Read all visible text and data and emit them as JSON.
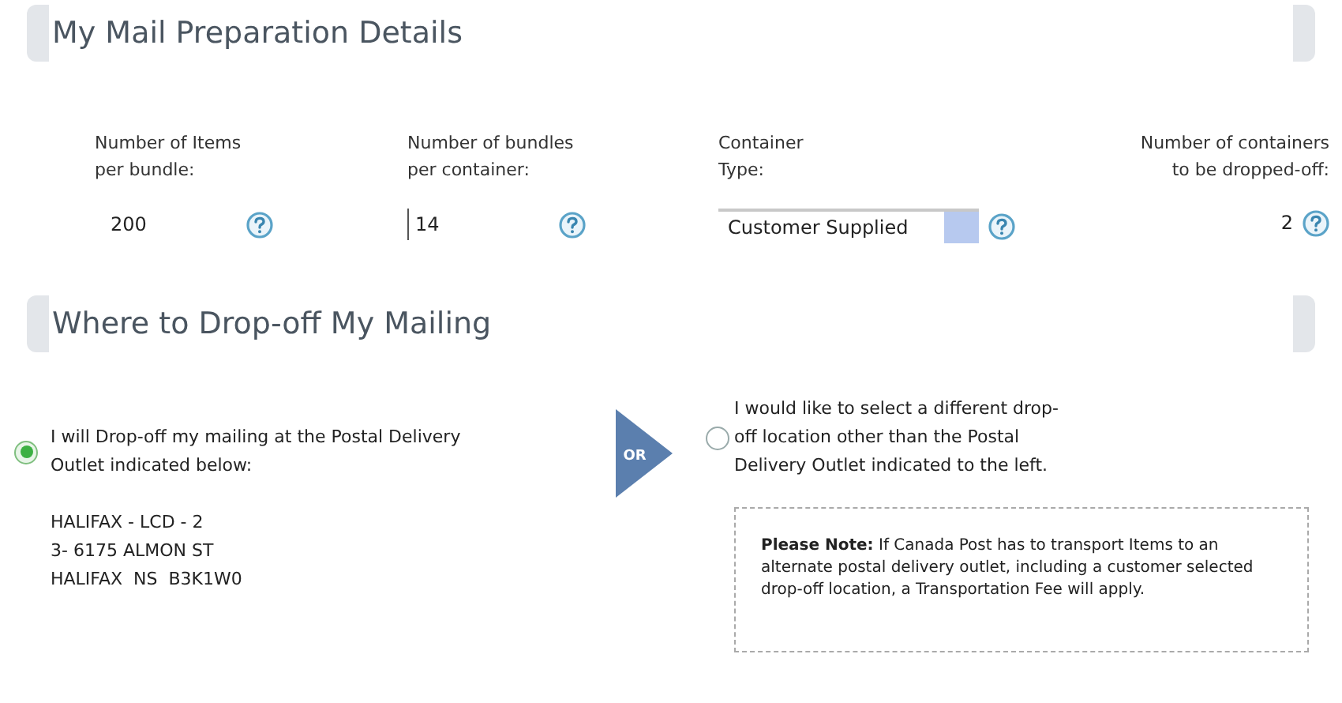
{
  "sections": [
    {
      "title": "My Mail Preparation Details"
    },
    {
      "title": "Where to Drop-off My Mailing"
    }
  ],
  "fields": [
    {
      "kind": "text",
      "label_lines": [
        "Number of Items",
        "per bundle:"
      ],
      "value": "200"
    },
    {
      "kind": "text-bordered",
      "label_lines": [
        "Number of bundles",
        "per container:"
      ],
      "value": "14"
    },
    {
      "kind": "select",
      "label_lines": [
        "Container",
        "Type:"
      ],
      "value": "Customer Supplied"
    },
    {
      "kind": "plain",
      "label_lines": [
        "Number of containers",
        "to be dropped-off:"
      ],
      "value": "2"
    }
  ],
  "dropoff": {
    "options": [
      {
        "label": "I will Drop-off my mailing at the Postal Delivery Outlet indicated below:",
        "selected": true
      },
      {
        "label": "I would like to select a different drop-off location other than the Postal Delivery Outlet indicated to the left.",
        "selected": false
      }
    ],
    "or_label": "OR",
    "address_lines": [
      "HALIFAX - LCD - 2",
      "3- 6175 ALMON ST",
      "HALIFAX  NS  B3K1W0"
    ],
    "note": "**Please Note:**  If Canada Post has to transport Items to an alternate postal delivery outlet, including a customer selected drop-off location, a Transportation Fee will apply."
  }
}
